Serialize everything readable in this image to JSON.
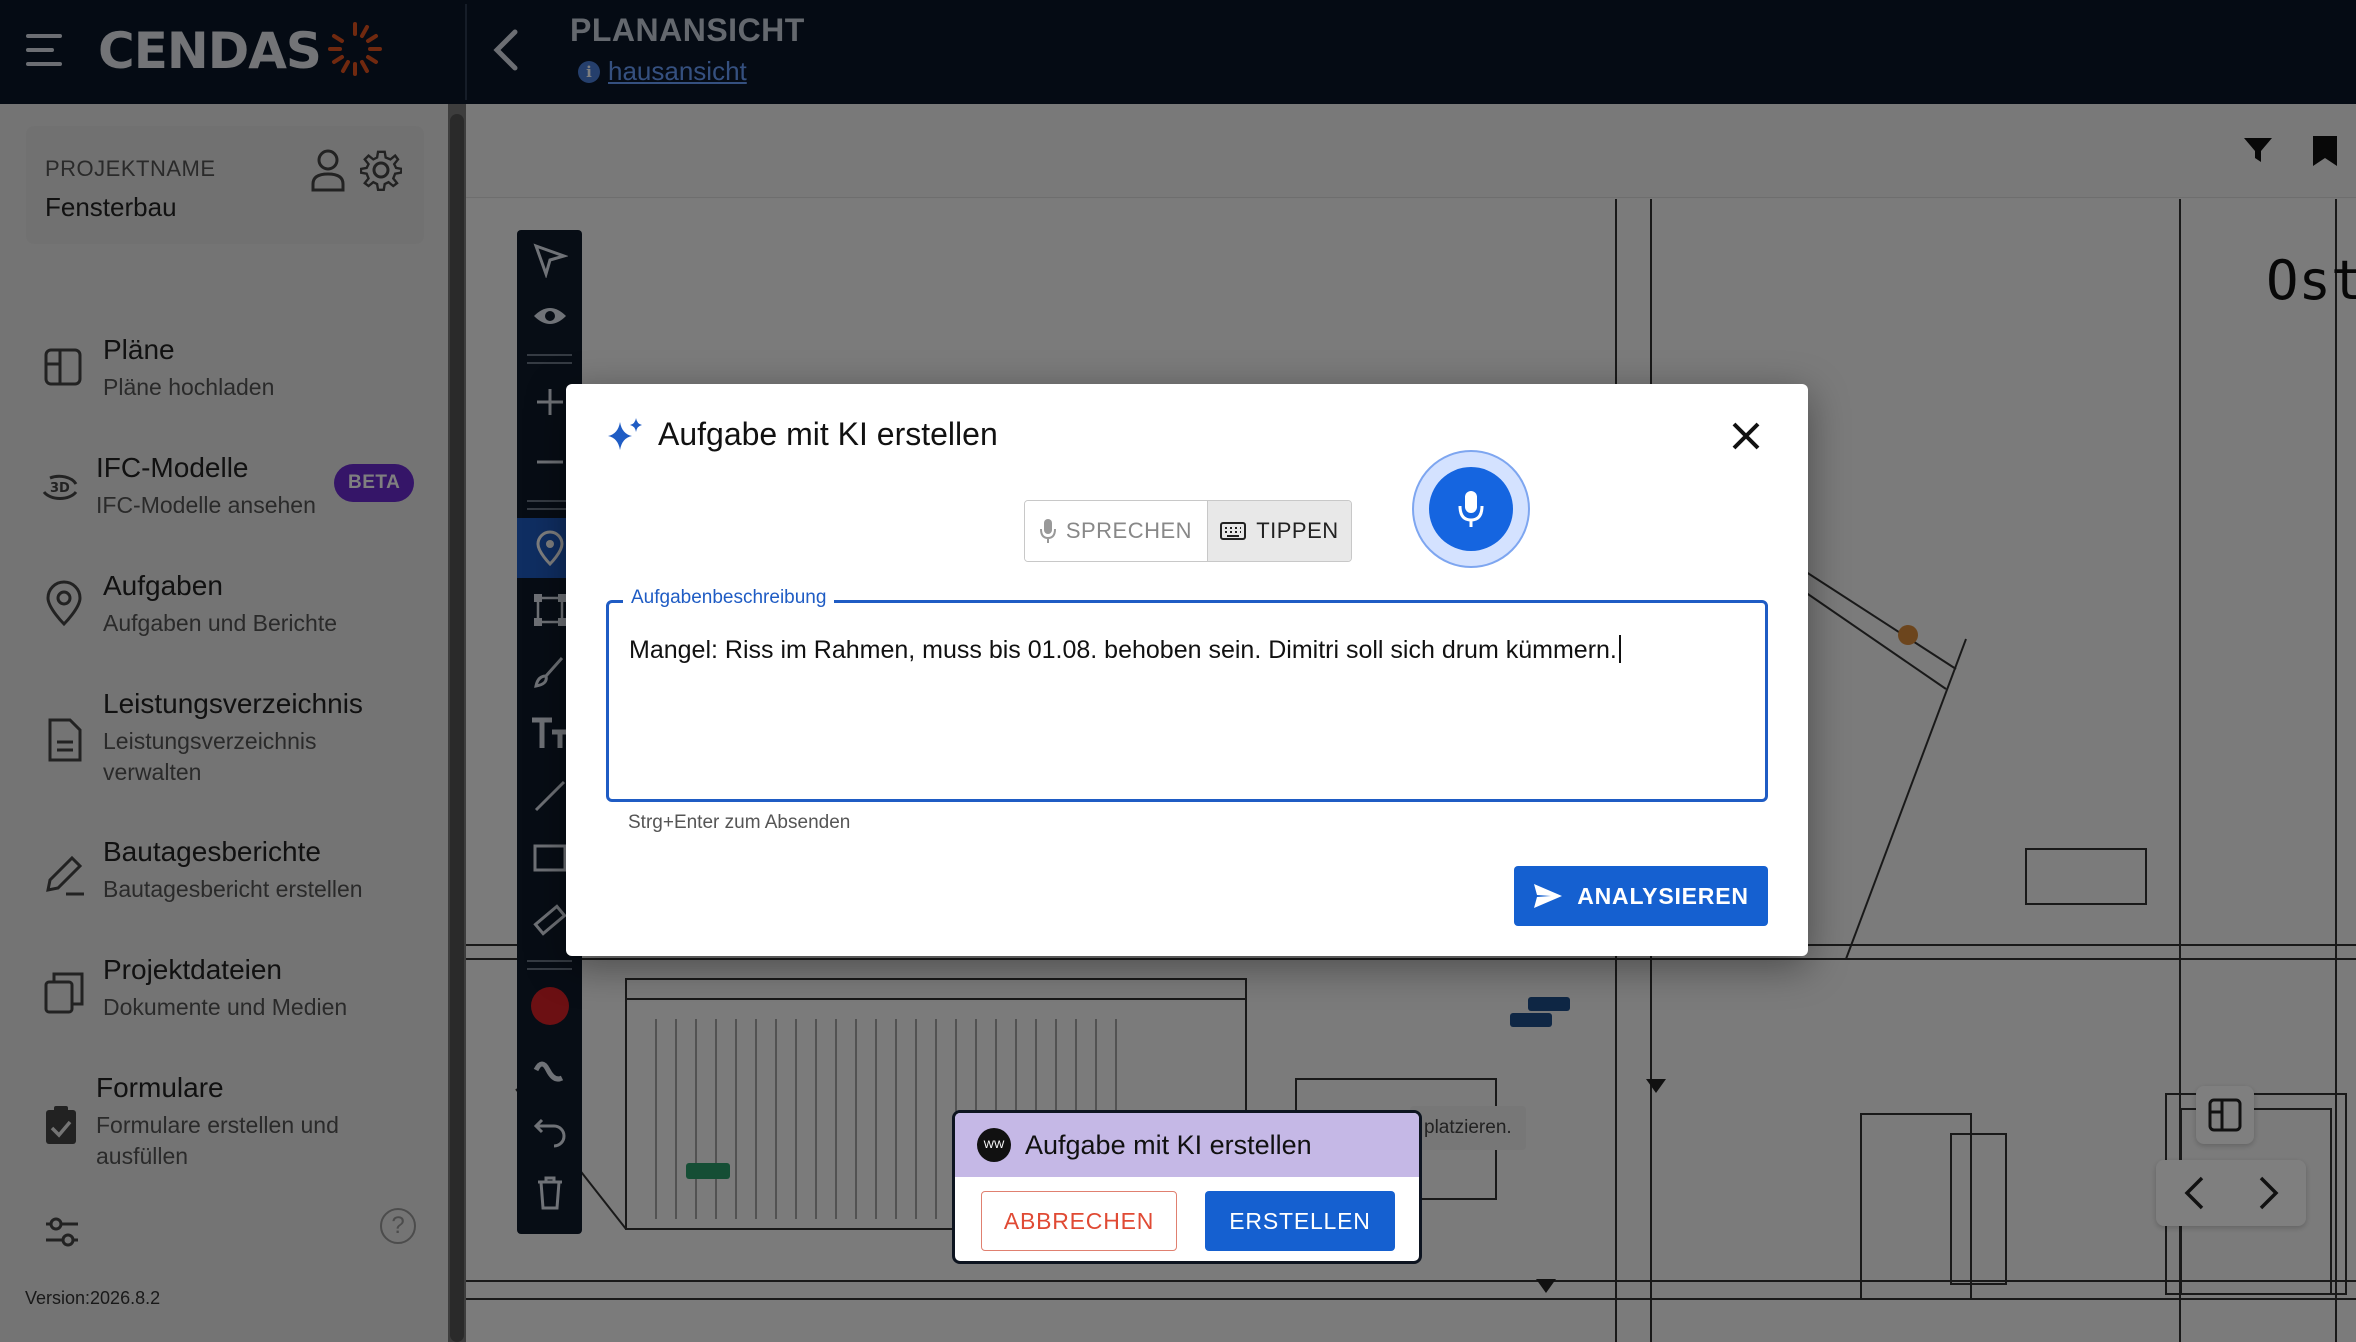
{
  "app": {
    "name": "CENDAS"
  },
  "header": {
    "title": "PLANANSICHT",
    "plan_link": "hausansicht"
  },
  "project": {
    "label": "PROJEKTNAME",
    "name": "Fensterbau"
  },
  "sidebar": {
    "items": [
      {
        "title": "Pläne",
        "subtitle": "Pläne hochladen",
        "icon": "plans-icon"
      },
      {
        "title": "IFC-Modelle",
        "subtitle": "IFC-Modelle ansehen",
        "icon": "3d-rotate-icon",
        "badge": "BETA"
      },
      {
        "title": "Aufgaben",
        "subtitle": "Aufgaben und Berichte",
        "icon": "location-pin-icon"
      },
      {
        "title": "Leistungsverzeichnis",
        "subtitle": "Leistungsverzeichnis verwalten",
        "icon": "document-icon"
      },
      {
        "title": "Bautagesberichte",
        "subtitle": "Bautagesbericht erstellen",
        "icon": "pen-icon"
      },
      {
        "title": "Projektdateien",
        "subtitle": "Dokumente und Medien",
        "icon": "copy-icon"
      },
      {
        "title": "Formulare",
        "subtitle": "Formulare erstellen und ausfüllen",
        "icon": "clipboard-check-icon"
      }
    ],
    "version": "Version:2026.8.2",
    "help": "?"
  },
  "plan_overlay": {
    "partial_heading": "Ost",
    "partial_tip": "platzieren."
  },
  "modal": {
    "title": "Aufgabe mit KI erstellen",
    "mode_speak": "SPRECHEN",
    "mode_type": "TIPPEN",
    "field_label": "Aufgabenbeschreibung",
    "field_value": "Mangel: Riss im Rahmen, muss bis 01.08. behoben sein. Dimitri soll sich drum kümmern.",
    "hint": "Strg+Enter zum Absenden",
    "analyze_label": "ANALYSIEREN"
  },
  "mini_dialog": {
    "title": "Aufgabe mit KI erstellen",
    "avatar_initials": "WW",
    "cancel_label": "ABBRECHEN",
    "create_label": "ERSTELLEN"
  },
  "colors": {
    "topbar": "#0a1628",
    "accent": "#1560d0",
    "beta": "#6a2bd1",
    "cancel": "#e04a34",
    "record": "#d92027"
  }
}
